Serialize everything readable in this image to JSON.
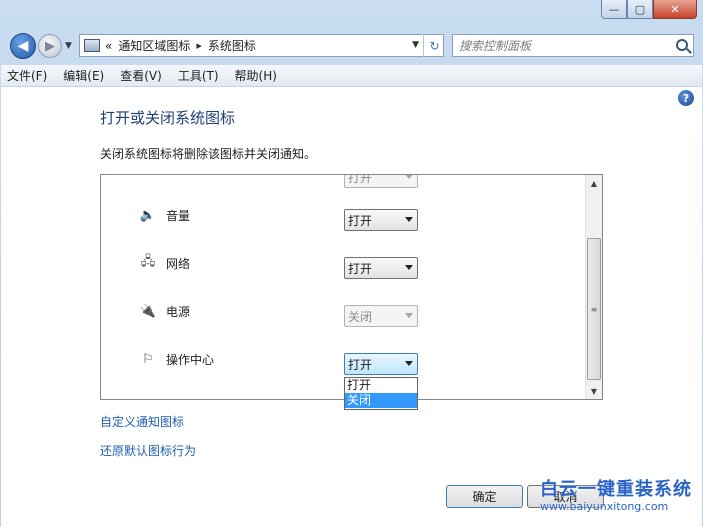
{
  "window": {
    "min": "—",
    "max": "▢",
    "close": "✕"
  },
  "nav": {
    "back_icon": "arrow-left-icon",
    "forward_icon": "arrow-right-icon",
    "breadcrumb_prefix": "«",
    "crumbs": [
      "通知区域图标",
      "系统图标"
    ],
    "separator": "▸",
    "search_placeholder": "搜索控制面板"
  },
  "menu": {
    "items": [
      "文件(F)",
      "编辑(E)",
      "查看(V)",
      "工具(T)",
      "帮助(H)"
    ]
  },
  "main": {
    "title": "打开或关闭系统图标",
    "description": "关闭系统图标将删除该图标并关闭通知。",
    "top_cut_value": "打开",
    "rows": [
      {
        "icon": "speaker-icon",
        "glyph": "🔈",
        "label": "音量",
        "value": "打开",
        "disabled": false
      },
      {
        "icon": "network-icon",
        "glyph": "🖧",
        "label": "网络",
        "value": "打开",
        "disabled": false
      },
      {
        "icon": "power-icon",
        "glyph": "🔌",
        "label": "电源",
        "value": "关闭",
        "disabled": true
      },
      {
        "icon": "flag-icon",
        "glyph": "⚐",
        "label": "操作中心",
        "value": "打开",
        "disabled": false
      }
    ],
    "dropdown_options": [
      "打开",
      "关闭"
    ],
    "dropdown_selected": "关闭",
    "links": [
      "自定义通知图标",
      "还原默认图标行为"
    ]
  },
  "footer": {
    "ok_label": "确定",
    "cancel_label": "取消"
  },
  "watermark": {
    "title": "白云一键重装系统",
    "url": "www.baiyunxitong.com"
  },
  "colors": {
    "accent": "#1e5eb2",
    "title": "#1e3f7a",
    "selection": "#3399ff"
  }
}
